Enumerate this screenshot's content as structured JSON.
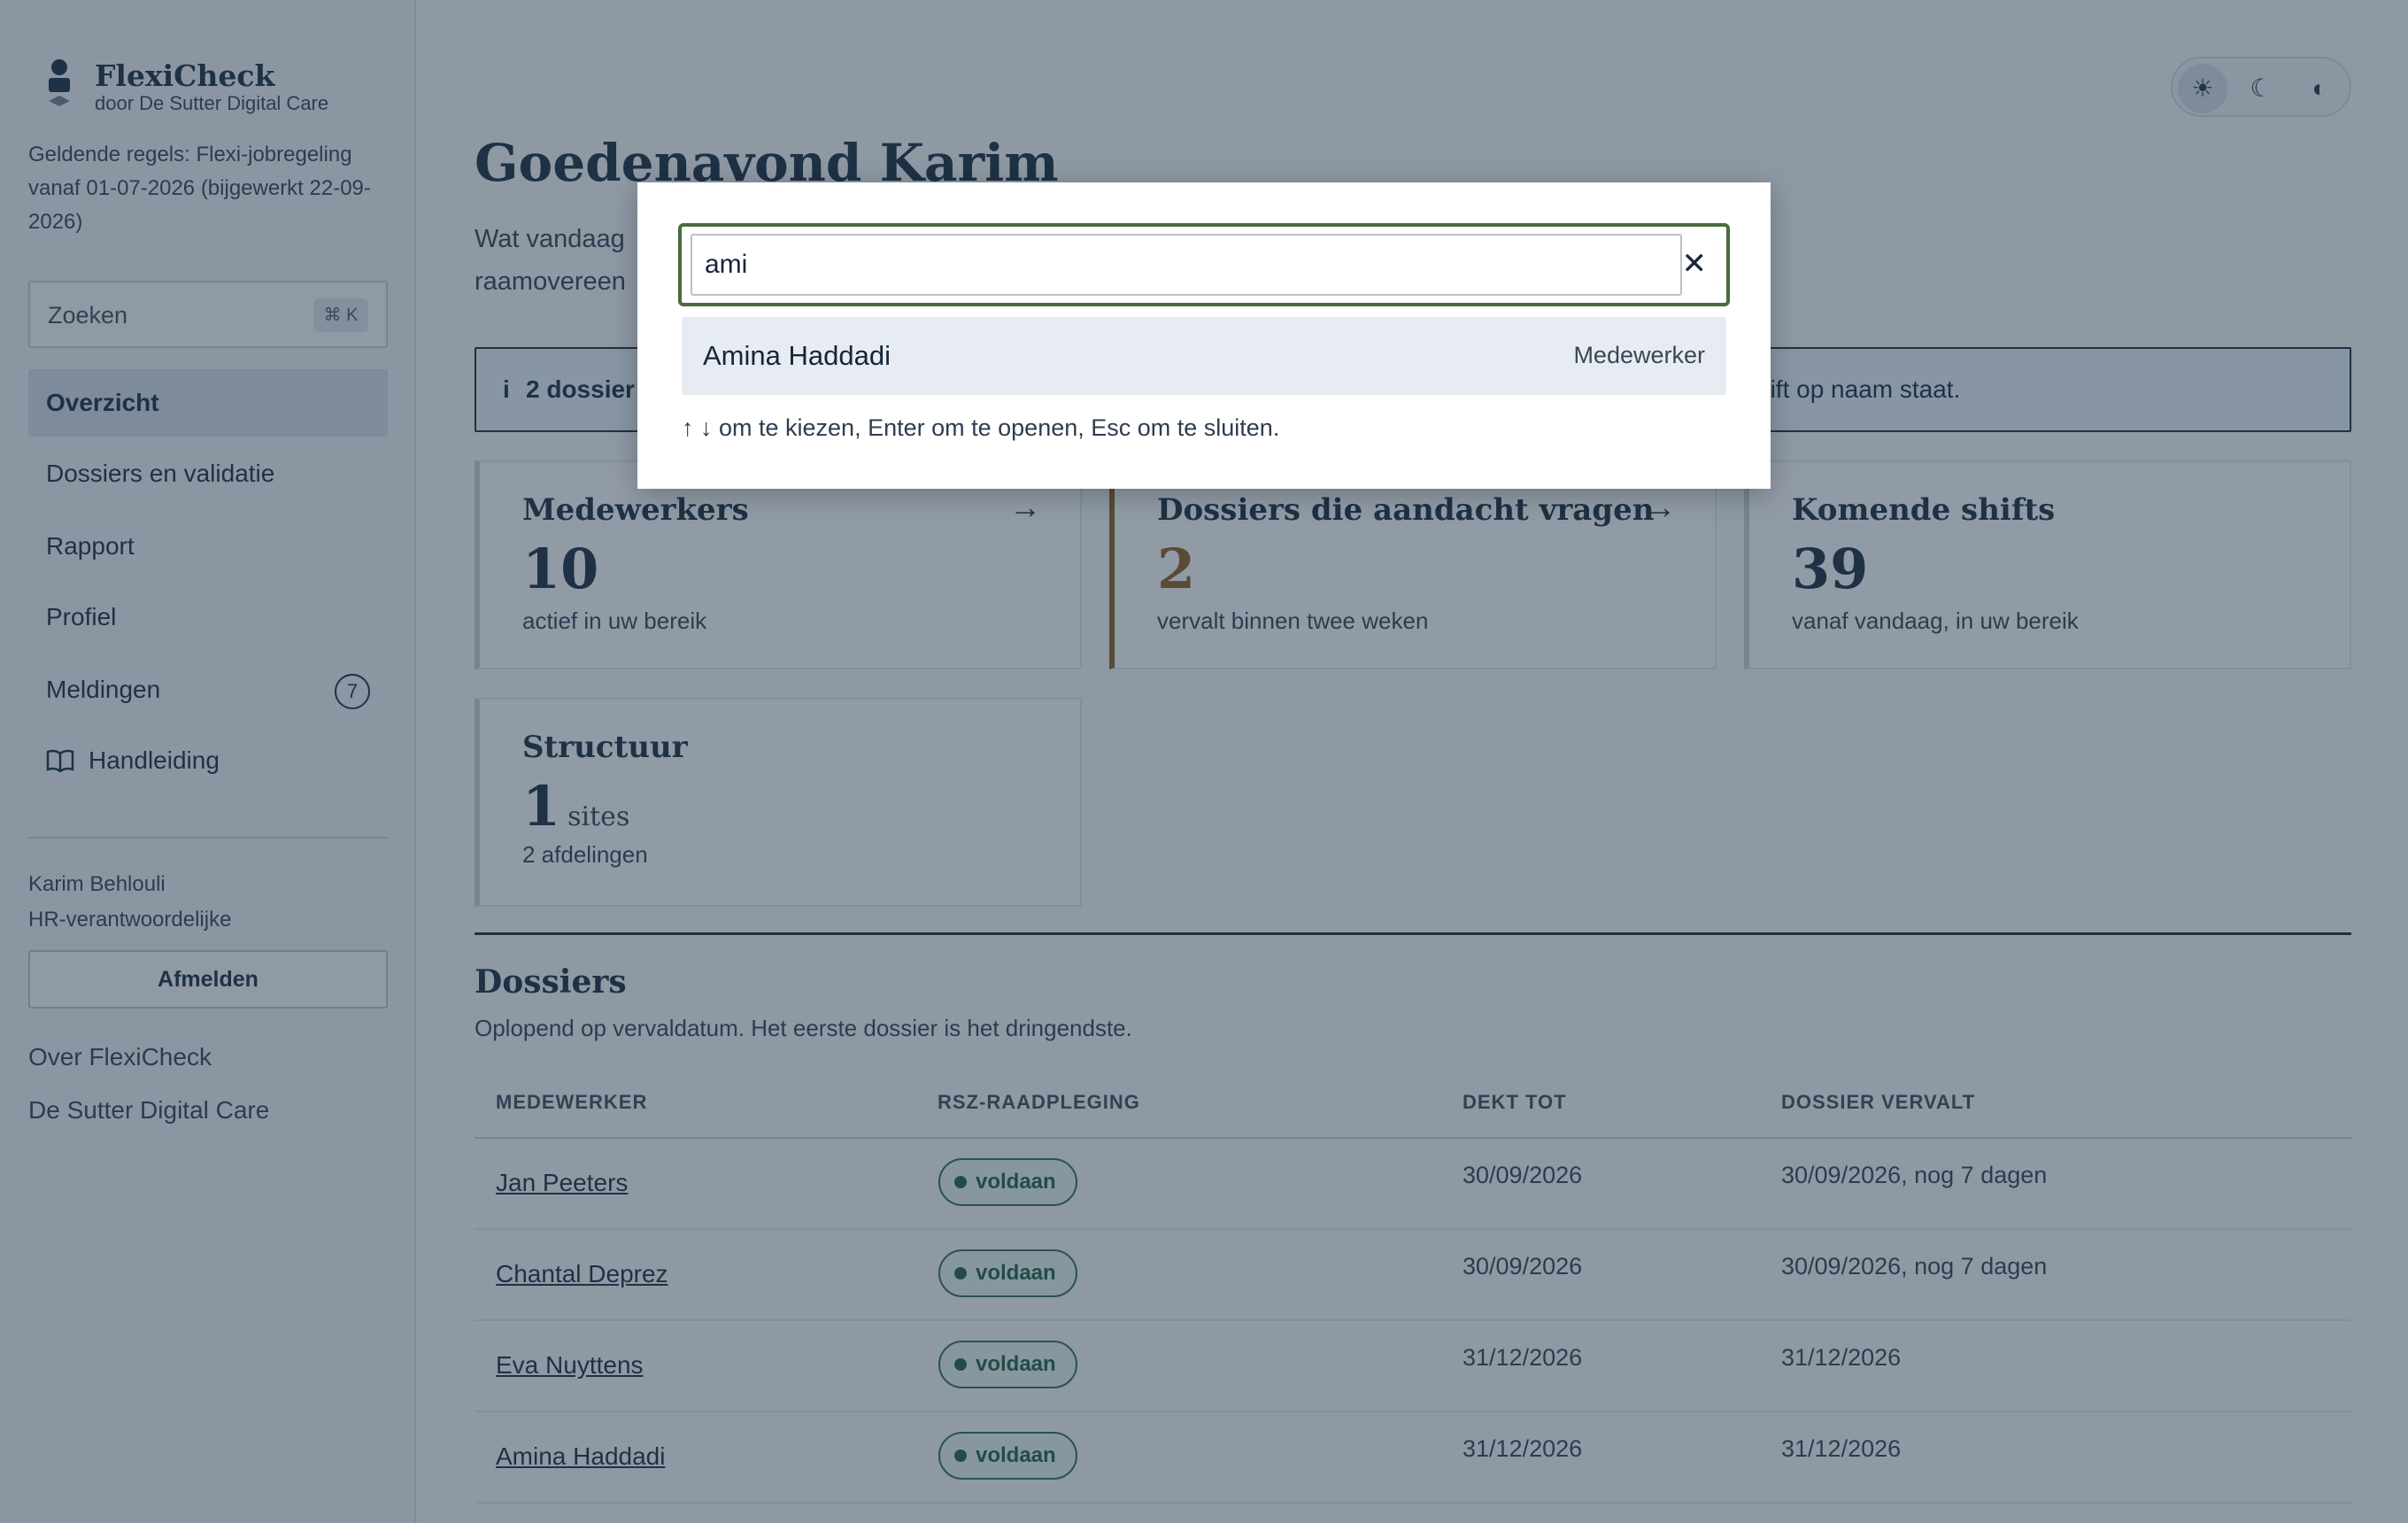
{
  "brand": {
    "name": "FlexiCheck",
    "subtitle": "door De Sutter Digital Care",
    "logo_icon": "person-logo-icon"
  },
  "rules_text": "Geldende regels: Flexi-jobregeling vanaf 01-07-2026 (bijgewerkt 22-09-2026)",
  "search": {
    "placeholder": "Zoeken",
    "shortcut": "⌘ K"
  },
  "nav": [
    {
      "label": "Overzicht",
      "active": true
    },
    {
      "label": "Dossiers en validatie"
    },
    {
      "label": "Rapport"
    },
    {
      "label": "Profiel"
    },
    {
      "label": "Meldingen",
      "badge": "7"
    },
    {
      "label": "Handleiding",
      "icon": "book-icon"
    }
  ],
  "user": {
    "name": "Karim Behlouli",
    "role": "HR-verantwoordelijke",
    "logout_label": "Afmelden"
  },
  "footer_links": [
    "Over FlexiCheck",
    "De Sutter Digital Care"
  ],
  "theme": {
    "options": [
      "sun-icon",
      "moon-icon",
      "contrast-icon"
    ],
    "active": "sun-icon"
  },
  "greeting": "Goedenavond Karim",
  "intro_line1": "Wat vandaag",
  "intro_line2": "raamovereen",
  "info": {
    "icon": "i",
    "text_start": "2 dossier",
    "text_end": "hift op naam staat."
  },
  "cards": [
    {
      "title": "Medewerkers",
      "value": "10",
      "sub": "actief in uw bereik",
      "arrow": "→"
    },
    {
      "title": "Dossiers die aandacht vragen",
      "value": "2",
      "sub": "vervalt binnen twee weken",
      "arrow": "→"
    },
    {
      "title": "Komende shifts",
      "value": "39",
      "sub": "vanaf vandaag, in uw bereik"
    },
    {
      "title": "Structuur",
      "value": "1",
      "unit": "sites",
      "sub": "2 afdelingen"
    }
  ],
  "dossiers": {
    "title": "Dossiers",
    "subtitle": "Oplopend op vervaldatum. Het eerste dossier is het dringendste.",
    "columns": [
      "MEDEWERKER",
      "RSZ-RAADPLEGING",
      "DEKT TOT",
      "DOSSIER VERVALT"
    ],
    "rows": [
      {
        "name": "Jan Peeters",
        "status": "voldaan",
        "covers_until": "30/09/2026",
        "expires": "30/09/2026, nog 7 dagen"
      },
      {
        "name": "Chantal Deprez",
        "status": "voldaan",
        "covers_until": "30/09/2026",
        "expires": "30/09/2026, nog 7 dagen"
      },
      {
        "name": "Eva Nuyttens",
        "status": "voldaan",
        "covers_until": "31/12/2026",
        "expires": "31/12/2026"
      },
      {
        "name": "Amina Haddadi",
        "status": "voldaan",
        "covers_until": "31/12/2026",
        "expires": "31/12/2026"
      }
    ]
  },
  "palette": {
    "accent_success": "#1e5a42",
    "accent_warning": "#8a5a1a",
    "navy": "#15263b"
  },
  "command_palette": {
    "query": "ami",
    "clear_icon": "close-icon",
    "results": [
      {
        "name": "Amina Haddadi",
        "type": "Medewerker"
      }
    ],
    "hint": "↑ ↓ om te kiezen, Enter om te openen, Esc om te sluiten."
  }
}
